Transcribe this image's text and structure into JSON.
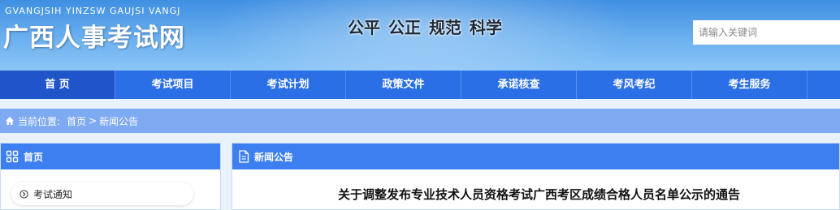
{
  "header": {
    "logo_en": "GVANGJSIH YINZSW GAUJSI VANGJ",
    "logo_cn": "广西人事考试网",
    "slogan": [
      "公平",
      "公正",
      "规范",
      "科学"
    ],
    "search_placeholder": "请输入关键词"
  },
  "nav": {
    "items": [
      {
        "label": "首 页"
      },
      {
        "label": "考试项目"
      },
      {
        "label": "考试计划"
      },
      {
        "label": "政策文件"
      },
      {
        "label": "承诺核查"
      },
      {
        "label": "考风考纪"
      },
      {
        "label": "考生服务"
      }
    ]
  },
  "breadcrumb": {
    "prefix": "当前位置:",
    "home": "首页",
    "separator": ">",
    "current": "新闻公告"
  },
  "sidebar": {
    "title": "首页",
    "items": [
      {
        "label": "考试通知"
      }
    ]
  },
  "main": {
    "section_title": "新闻公告",
    "article_title": "关于调整发布专业技术人员资格考试广西考区成绩合格人员名单公示的通告"
  },
  "colors": {
    "nav_bg": "#2a6fe6",
    "nav_active": "#1f55c8",
    "breadcrumb_bg": "#7eaaf2",
    "panel_head": "#3d7ff0"
  }
}
